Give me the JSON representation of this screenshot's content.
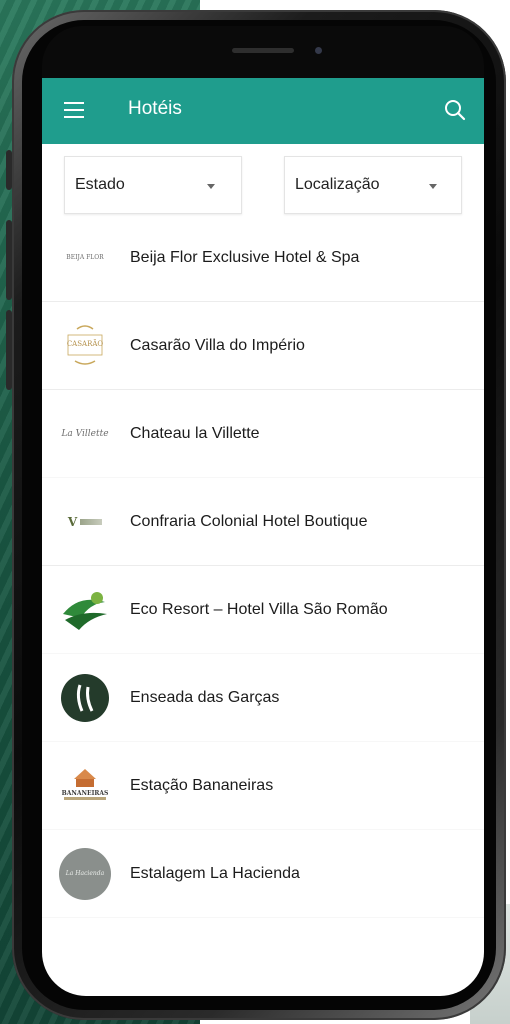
{
  "colors": {
    "accent": "#1f9d8d",
    "appbar_text": "#ffffff",
    "text": "#1c1c1c"
  },
  "appbar": {
    "title": "Hotéis",
    "menu_icon": "menu-icon",
    "search_icon": "search-icon"
  },
  "filters": {
    "state": {
      "label": "Estado",
      "icon": "dropdown-caret-icon"
    },
    "location": {
      "label": "Localização",
      "icon": "dropdown-caret-icon"
    }
  },
  "hotels": [
    {
      "name": "Beija Flor Exclusive Hotel & Spa",
      "logo_text": "BEIJA FLOR"
    },
    {
      "name": "Casarão Villa do Império",
      "logo_text": "CASARÃO"
    },
    {
      "name": "Chateau la Villette",
      "logo_text": "La Villette"
    },
    {
      "name": "Confraria Colonial Hotel Boutique",
      "logo_text": "V"
    },
    {
      "name": "Eco Resort – Hotel Villa São Romão",
      "logo_text": ""
    },
    {
      "name": "Enseada das Garças",
      "logo_text": ""
    },
    {
      "name": "Estação Bananeiras",
      "logo_text": "BANANEIRAS"
    },
    {
      "name": "Estalagem La Hacienda",
      "logo_text": "La Hacienda"
    }
  ]
}
